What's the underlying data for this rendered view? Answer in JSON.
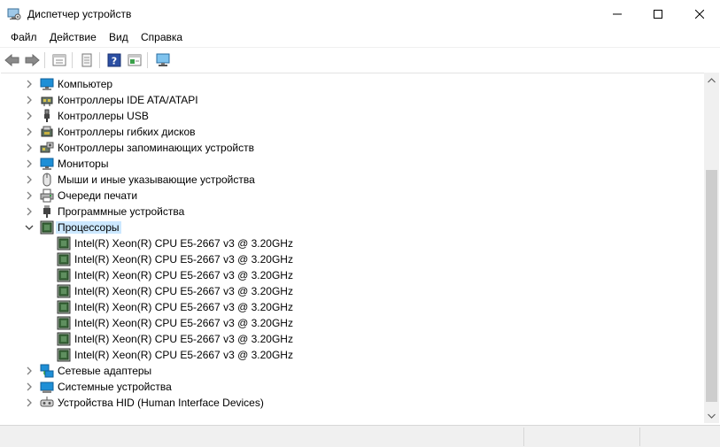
{
  "window": {
    "title": "Диспетчер устройств",
    "icon": "device-manager-icon"
  },
  "menu": [
    {
      "label": "Файл"
    },
    {
      "label": "Действие"
    },
    {
      "label": "Вид"
    },
    {
      "label": "Справка"
    }
  ],
  "toolbar": {
    "buttons": [
      "back-arrow-icon",
      "forward-arrow-icon",
      "properties-icon",
      "update-driver-icon",
      "help-icon",
      "action-view-icon",
      "scan-hardware-icon"
    ]
  },
  "tree": {
    "categories": [
      {
        "label": "Компьютер",
        "icon": "computer-icon",
        "expanded": false
      },
      {
        "label": "Контроллеры IDE ATA/ATAPI",
        "icon": "ide-controller-icon",
        "expanded": false
      },
      {
        "label": "Контроллеры USB",
        "icon": "usb-icon",
        "expanded": false
      },
      {
        "label": "Контроллеры гибких дисков",
        "icon": "floppy-controller-icon",
        "expanded": false
      },
      {
        "label": "Контроллеры запоминающих устройств",
        "icon": "storage-controller-icon",
        "expanded": false
      },
      {
        "label": "Мониторы",
        "icon": "monitor-icon",
        "expanded": false
      },
      {
        "label": "Мыши и иные указывающие устройства",
        "icon": "mouse-icon",
        "expanded": false
      },
      {
        "label": "Очереди печати",
        "icon": "printer-icon",
        "expanded": false
      },
      {
        "label": "Программные устройства",
        "icon": "software-device-icon",
        "expanded": false
      },
      {
        "label": "Процессоры",
        "icon": "processor-icon",
        "expanded": true,
        "selected": true
      },
      {
        "label": "Сетевые адаптеры",
        "icon": "network-adapter-icon",
        "expanded": false
      },
      {
        "label": "Системные устройства",
        "icon": "system-device-icon",
        "expanded": false
      },
      {
        "label": "Устройства HID (Human Interface Devices)",
        "icon": "hid-icon",
        "expanded": false
      }
    ],
    "processors": [
      "Intel(R) Xeon(R) CPU E5-2667 v3 @ 3.20GHz",
      "Intel(R) Xeon(R) CPU E5-2667 v3 @ 3.20GHz",
      "Intel(R) Xeon(R) CPU E5-2667 v3 @ 3.20GHz",
      "Intel(R) Xeon(R) CPU E5-2667 v3 @ 3.20GHz",
      "Intel(R) Xeon(R) CPU E5-2667 v3 @ 3.20GHz",
      "Intel(R) Xeon(R) CPU E5-2667 v3 @ 3.20GHz",
      "Intel(R) Xeon(R) CPU E5-2667 v3 @ 3.20GHz",
      "Intel(R) Xeon(R) CPU E5-2667 v3 @ 3.20GHz"
    ]
  },
  "colors": {
    "selection": "#cce8ff",
    "monitor_blue": "#1e8fd6",
    "chip_green": "#3d6b3d"
  }
}
